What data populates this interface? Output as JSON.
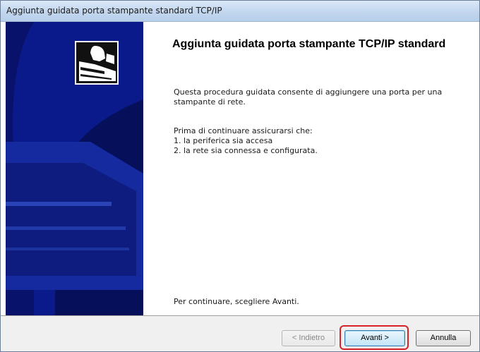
{
  "window": {
    "title": "Aggiunta guidata porta stampante standard TCP/IP"
  },
  "content": {
    "heading": "Aggiunta guidata porta stampante TCP/IP standard",
    "intro": "Questa procedura guidata consente di aggiungere una porta per una stampante di rete.",
    "prereq_title": "Prima di continuare assicurarsi che:",
    "prereq_items": [
      "1. la periferica sia accesa",
      "2. la rete sia connessa e configurata."
    ],
    "continue_hint": "Per continuare, scegliere Avanti."
  },
  "buttons": {
    "back_label": "< Indietro",
    "next_label": "Avanti >",
    "cancel_label": "Annulla"
  },
  "colors": {
    "side_panel": "#0b1a8a",
    "highlight": "#d7222a"
  },
  "icons": {
    "side_panel_graphic": "printer-wizard-icon"
  }
}
